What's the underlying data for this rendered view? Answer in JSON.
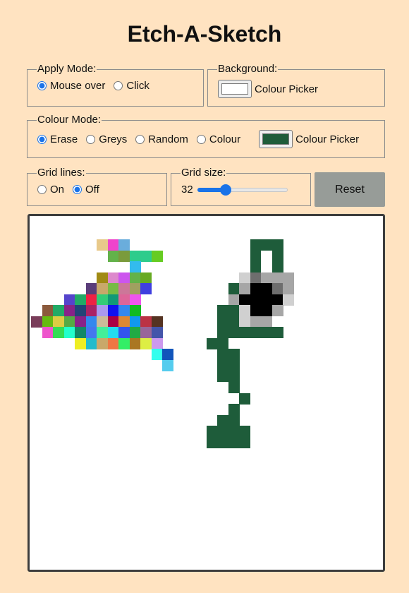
{
  "title": "Etch-A-Sketch",
  "apply_mode": {
    "legend": "Apply Mode:",
    "options": [
      "Mouse over",
      "Click"
    ],
    "selected": "Mouse over"
  },
  "background": {
    "legend": "Background:",
    "picker_label": "Colour Picker",
    "color": "#ffffff"
  },
  "colour_mode": {
    "legend": "Colour Mode:",
    "options": [
      "Erase",
      "Greys",
      "Random",
      "Colour"
    ],
    "selected": "Erase",
    "picker_label": "Colour Picker",
    "color": "#1e5c3a"
  },
  "grid_lines": {
    "legend": "Grid lines:",
    "options": [
      "On",
      "Off"
    ],
    "selected": "Off"
  },
  "grid_size": {
    "legend": "Grid size:",
    "value": "32",
    "min": 1,
    "max": 100
  },
  "reset_label": "Reset",
  "drawing": {
    "size": 32,
    "palette": {
      "G": "#1e5c3a",
      "W": "#ffffff",
      "L": "#d0d0d0",
      "M": "#a6a6a6",
      "D": "#6e6e6e",
      "K": "#000000",
      "a": "#e8c98a",
      "b": "#ee44cc",
      "c": "#6aaddc",
      "d": "#63b24a",
      "e": "#7a9b3c",
      "f": "#2ecc8c",
      "g": "#66cc22",
      "h": "#33bbee",
      "i": "#a08a14",
      "j": "#dd88cc",
      "k": "#cc55ee",
      "l": "#8b5a8a",
      "m": "#66aa22",
      "n": "#5a3d7a",
      "o": "#c9a86a",
      "p": "#77bb44",
      "q": "#cc7799",
      "r": "#a0a060",
      "s": "#3f3fdf",
      "t": "#5544cc",
      "u": "#22aa66",
      "v": "#ee2244",
      "w": "#33cc77",
      "x": "#119977",
      "y": "#dd6699",
      "z": "#ee55ee",
      "A": "#8b5a3c",
      "B": "#22aa66",
      "C": "#882288",
      "E": "#224477",
      "F": "#aa2266",
      "H": "#aa99ee",
      "I": "#1111ee",
      "J": "#3388ee",
      "N": "#11bb22",
      "O": "#7a3d5a",
      "P": "#66bb11",
      "Q": "#ddcc44",
      "R": "#55aa44",
      "S": "#eeaa22",
      "T": "#ccbb99",
      "U": "#aa0044",
      "V": "#dd8833",
      "X": "#1199ee",
      "Y": "#bb3344",
      "Z": "#553322",
      "0": "#ee55cc",
      "1": "#33dd55",
      "2": "#22ffcc",
      "3": "#118866",
      "4": "#4477ee",
      "5": "#44ee99",
      "6": "#22ddee",
      "7": "#3355ee",
      "8": "#22aa44",
      "9": "#4455aa",
      "!": "#996699",
      "@": "#eeee22",
      "#": "#22bbcc",
      "$": "#c9a86a",
      "%": "#ee7744",
      "^": "#33ee66",
      "&": "#aa7722",
      "*": "#ddee44",
      "(": "#cc99ee",
      ")": "#33ffee",
      "[": "#1155bb",
      "]": "#55ccee"
    },
    "rows": [
      "................................",
      "................................",
      "......abc...........GGG.........",
      ".......deffg........GWG.........",
      ".........h..........GWG.........",
      "......ijkdm........LDMMM........",
      ".....nopqrs.......GMKKDM........",
      "...tuvwxyz.......WMKKKKL........",
      ".ABCEFHIJN.......GGLKKM.........",
      "OPQRCJTUVXYZ.....GGLMMW.........",
      ".012345678!9.....GGGGGG.........",
      "....@#$%^&*(....GG...............",
      "...........)[....GG.............",
      "............]....GG.............",
      ".................GG.............",
      "..................G.............",
      "...................G............",
      "..................G.............",
      ".................GG.............",
      "................GGGG............",
      "................GGGG............",
      "................................",
      "................................",
      "................................",
      "................................",
      "................................",
      "................................",
      "................................",
      "................................",
      "................................",
      "................................",
      "................................"
    ]
  }
}
